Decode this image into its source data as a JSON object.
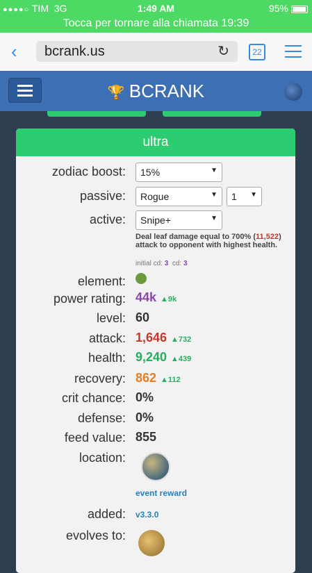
{
  "status": {
    "carrier": "TIM",
    "network": "3G",
    "time": "1:49 AM",
    "battery": "95%"
  },
  "call_bar": "Tocca per tornare alla chiamata 19:39",
  "browser": {
    "url": "bcrank.us",
    "tab_count": "22"
  },
  "nav": {
    "brand": "BCRANK"
  },
  "card": {
    "title": "ultra",
    "labels": {
      "zodiac": "zodiac boost:",
      "passive": "passive:",
      "active": "active:",
      "element": "element:",
      "power": "power rating:",
      "level": "level:",
      "attack": "attack:",
      "health": "health:",
      "recovery": "recovery:",
      "crit": "crit chance:",
      "defense": "defense:",
      "feed": "feed value:",
      "location": "location:",
      "added": "added:",
      "evolves": "evolves to:"
    },
    "zodiac_value": "15%",
    "passive_value": "Rogue",
    "passive_level": "1",
    "active_value": "Snipe+",
    "desc_prefix": "Deal leaf damage equal to 700% (",
    "desc_num": "11,522",
    "desc_suffix": ") attack to opponent with highest health.",
    "cd_initial_label": "initial cd:",
    "cd_initial": "3",
    "cd_label": "cd:",
    "cd": "3",
    "element_icon": "leaf-icon",
    "power": "44k",
    "power_inc": "▲9k",
    "level": "60",
    "attack": "1,646",
    "attack_inc": "▲732",
    "health": "9,240",
    "health_inc": "▲439",
    "recovery": "862",
    "recovery_inc": "▲112",
    "crit": "0%",
    "defense": "0%",
    "feed": "855",
    "location_link": "event reward",
    "added_link": "v3.3.0"
  },
  "colors": {
    "green": "#2ecc71",
    "nav": "#3d6fb5",
    "power": "#8e44ad",
    "attack": "#c0392b",
    "health": "#27ae60",
    "recovery": "#e67e22"
  }
}
